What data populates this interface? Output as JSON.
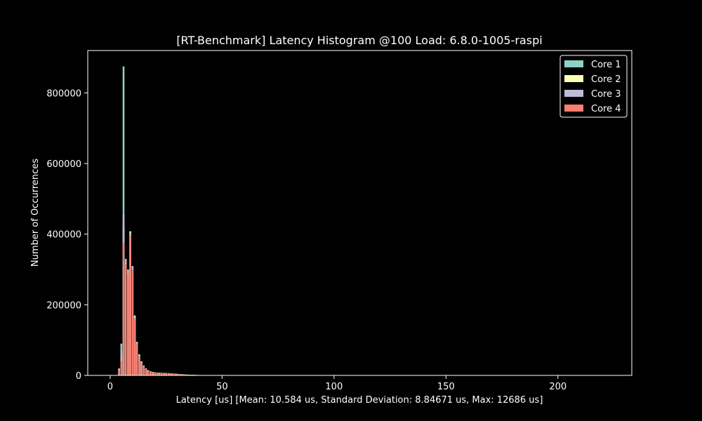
{
  "chart_data": {
    "type": "bar",
    "title": "[RT-Benchmark] Latency Histogram @100 Load: 6.8.0-1005-raspi",
    "xlabel": "Latency [us] [Mean: 10.584 us, Standard Deviation: 8.84671 us, Max: 12686 us]",
    "ylabel": "Number of Occurrences",
    "xlim": [
      -10,
      233
    ],
    "ylim": [
      0,
      920000
    ],
    "xticks": [
      0,
      50,
      100,
      150,
      200
    ],
    "yticks": [
      0,
      200000,
      400000,
      600000,
      800000
    ],
    "legend_position": "top-right",
    "colors": {
      "background": "#000000",
      "foreground": "#ffffff"
    },
    "x": [
      4,
      5,
      6,
      7,
      8,
      9,
      10,
      11,
      12,
      13,
      14,
      15,
      16,
      17,
      18,
      19,
      20,
      21,
      22,
      23,
      24,
      25,
      26,
      27,
      28,
      29,
      30,
      31,
      32,
      33,
      34,
      35,
      36,
      37,
      38,
      39,
      40,
      41,
      42,
      43,
      44
    ],
    "series": [
      {
        "name": "Core 1",
        "color": "#8dd3c7",
        "values": [
          20000,
          90000,
          875000,
          330000,
          300000,
          400000,
          310000,
          170000,
          95000,
          60000,
          40000,
          28000,
          20000,
          15000,
          12000,
          10000,
          9000,
          8000,
          8000,
          7500,
          7000,
          7000,
          6500,
          6000,
          5500,
          5000,
          4500,
          4000,
          3500,
          3000,
          2500,
          2000,
          1800,
          1600,
          1400,
          1200,
          1000,
          800,
          700,
          600,
          500
        ]
      },
      {
        "name": "Core 2",
        "color": "#ffffb3",
        "values": [
          18000,
          60000,
          420000,
          320000,
          295000,
          408000,
          305000,
          168000,
          93000,
          58000,
          38000,
          27000,
          19000,
          14000,
          11500,
          9500,
          8800,
          7800,
          7800,
          7200,
          6800,
          6800,
          6300,
          5800,
          5300,
          4800,
          4300,
          3800,
          3300,
          2800,
          2300,
          1900,
          1700,
          1500,
          1300,
          1100,
          900,
          750,
          650,
          550,
          450
        ]
      },
      {
        "name": "Core 3",
        "color": "#bebada",
        "values": [
          19000,
          70000,
          455000,
          322000,
          297000,
          404000,
          307000,
          165000,
          92000,
          57000,
          37000,
          26000,
          18500,
          13500,
          11000,
          9300,
          8600,
          7600,
          7600,
          7000,
          6600,
          6600,
          6100,
          5600,
          5100,
          4600,
          4100,
          3600,
          3100,
          2600,
          2100,
          1800,
          1600,
          1400,
          1200,
          1000,
          850,
          700,
          600,
          500,
          400
        ]
      },
      {
        "name": "Core 4",
        "color": "#fb8072",
        "values": [
          15000,
          40000,
          375000,
          315000,
          290000,
          395000,
          300000,
          160000,
          90000,
          55000,
          36000,
          25000,
          18000,
          13000,
          10500,
          9000,
          8400,
          7400,
          7400,
          6900,
          6500,
          6500,
          6000,
          5500,
          5000,
          4500,
          4000,
          3500,
          3000,
          2500,
          2000,
          1700,
          1500,
          1300,
          1100,
          950,
          800,
          650,
          550,
          450,
          350
        ]
      }
    ]
  }
}
